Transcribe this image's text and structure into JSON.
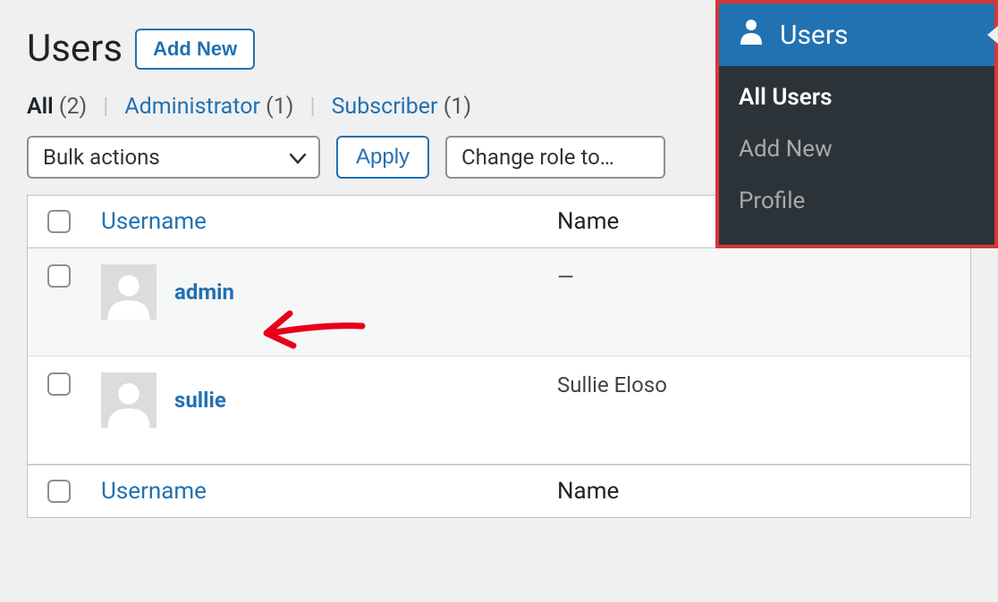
{
  "header": {
    "title": "Users",
    "add_new": "Add New"
  },
  "filters": {
    "all_label": "All",
    "all_count": "(2)",
    "admin_label": "Administrator",
    "admin_count": "(1)",
    "sub_label": "Subscriber",
    "sub_count": "(1)"
  },
  "actions": {
    "bulk_label": "Bulk actions",
    "apply_label": "Apply",
    "role_label": "Change role to…"
  },
  "table": {
    "col_username": "Username",
    "col_name": "Name",
    "rows": [
      {
        "username": "admin",
        "name": "—"
      },
      {
        "username": "sullie",
        "name": "Sullie Eloso"
      }
    ]
  },
  "sidebar": {
    "title": "Users",
    "items": [
      {
        "label": "All Users",
        "active": true
      },
      {
        "label": "Add New",
        "active": false
      },
      {
        "label": "Profile",
        "active": false
      }
    ]
  }
}
